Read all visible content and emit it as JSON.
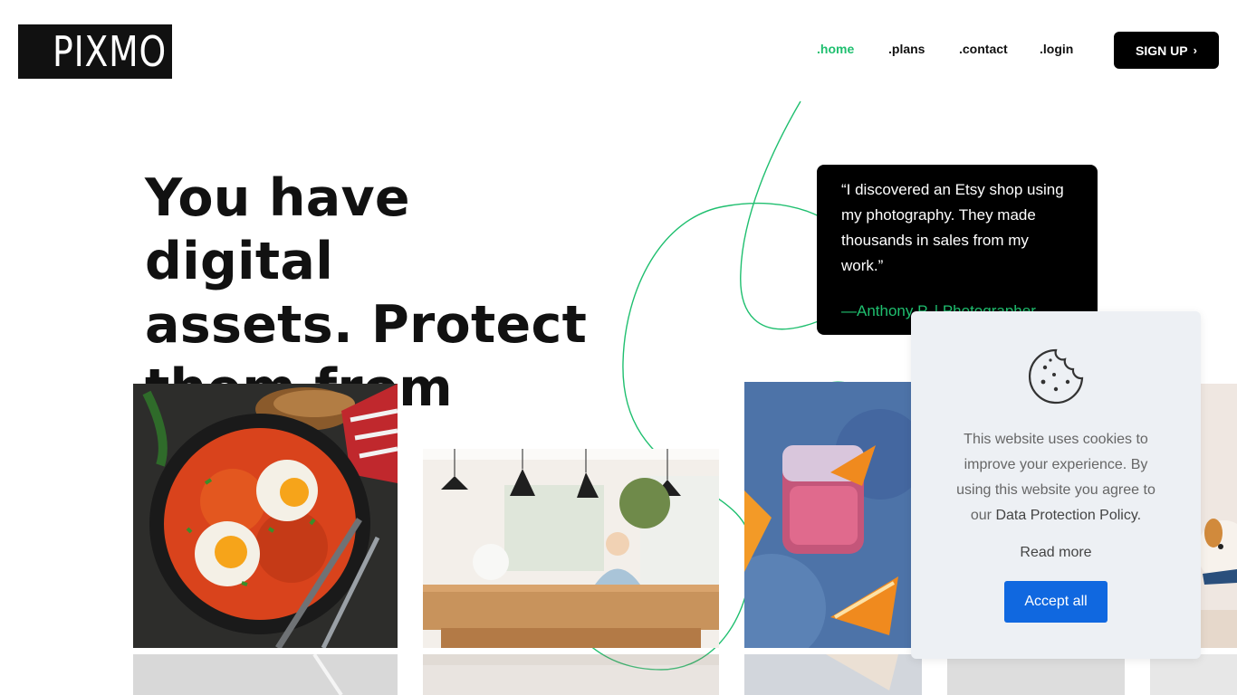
{
  "brand": {
    "logo_text": "PIXMO"
  },
  "nav": {
    "items": [
      {
        "label": ".home",
        "active": true
      },
      {
        "label": ".plans",
        "active": false
      },
      {
        "label": ".contact",
        "active": false
      },
      {
        "label": ".login",
        "active": false
      }
    ],
    "signup_label": "SIGN UP",
    "signup_icon": "chevron-right-icon"
  },
  "hero": {
    "headline_lines": [
      "You have digital",
      "assets. Protect",
      "them from theft."
    ]
  },
  "testimonial": {
    "quote": "“I discovered an Etsy shop using my photography. They made thousands in sales from my work.”",
    "author": "—Anthony P. | Photographer"
  },
  "gallery": {
    "photos": [
      "shakshuka-pan",
      "dining-room-woman",
      "pink-cocktail-orange",
      "dog-peeking"
    ]
  },
  "cookie_notice": {
    "icon": "cookie-icon",
    "text": "This website uses cookies to improve your experience. By using this website you agree to our",
    "policy_link": "Data Protection Policy.",
    "read_more": "Read more",
    "accept_label": "Accept all"
  },
  "colors": {
    "accent_green": "#1fbf6f",
    "accept_blue": "#1068e0",
    "dark": "#000000"
  }
}
